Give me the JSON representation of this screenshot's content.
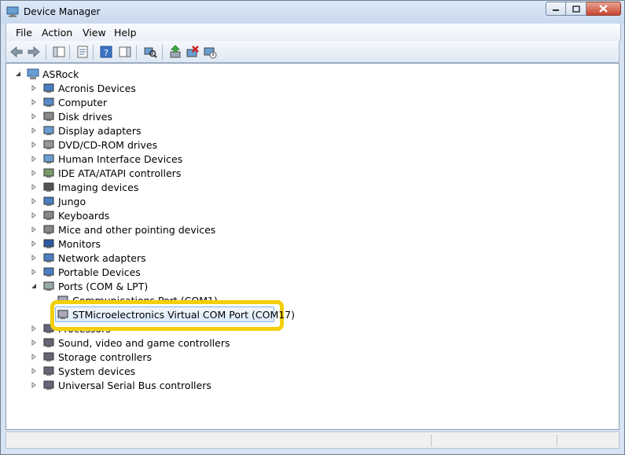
{
  "window": {
    "title": "Device Manager"
  },
  "menu": {
    "file": "File",
    "action": "Action",
    "view": "View",
    "help": "Help"
  },
  "toolbar": {
    "icons": [
      "back-arrow-icon",
      "forward-arrow-icon",
      "show-hide-console-tree-icon",
      "properties-icon",
      "help-icon",
      "action-pane-icon",
      "scan-hardware-icon",
      "update-driver-icon",
      "uninstall-icon",
      "disable-icon"
    ]
  },
  "tree": {
    "root": "ASRock",
    "categories": [
      {
        "label": "Acronis Devices",
        "icon": "acronis-icon"
      },
      {
        "label": "Computer",
        "icon": "computer-icon"
      },
      {
        "label": "Disk drives",
        "icon": "disk-drive-icon"
      },
      {
        "label": "Display adapters",
        "icon": "display-adapter-icon"
      },
      {
        "label": "DVD/CD-ROM drives",
        "icon": "dvd-icon"
      },
      {
        "label": "Human Interface Devices",
        "icon": "hid-icon"
      },
      {
        "label": "IDE ATA/ATAPI controllers",
        "icon": "ide-icon"
      },
      {
        "label": "Imaging devices",
        "icon": "camera-icon"
      },
      {
        "label": "Jungo",
        "icon": "jungo-icon"
      },
      {
        "label": "Keyboards",
        "icon": "keyboard-icon"
      },
      {
        "label": "Mice and other pointing devices",
        "icon": "mouse-icon"
      },
      {
        "label": "Monitors",
        "icon": "monitor-icon"
      },
      {
        "label": "Network adapters",
        "icon": "network-icon"
      },
      {
        "label": "Portable Devices",
        "icon": "portable-device-icon"
      },
      {
        "label": "Ports (COM & LPT)",
        "icon": "port-icon"
      }
    ],
    "ports_children": [
      {
        "label": "Communications Port (COM1)"
      },
      {
        "label": "STMicroelectronics Virtual COM Port (COM17)"
      }
    ],
    "after_categories": [
      {
        "label": "Processors",
        "icon": "processor-icon"
      },
      {
        "label": "Sound, video and game controllers",
        "icon": "speaker-icon"
      },
      {
        "label": "Storage controllers",
        "icon": "storage-icon"
      },
      {
        "label": "System devices",
        "icon": "system-device-icon"
      },
      {
        "label": "Universal Serial Bus controllers",
        "icon": "usb-icon"
      }
    ]
  },
  "colors": {
    "highlight": "#f2cf0a",
    "selection": "#dcebfb"
  }
}
